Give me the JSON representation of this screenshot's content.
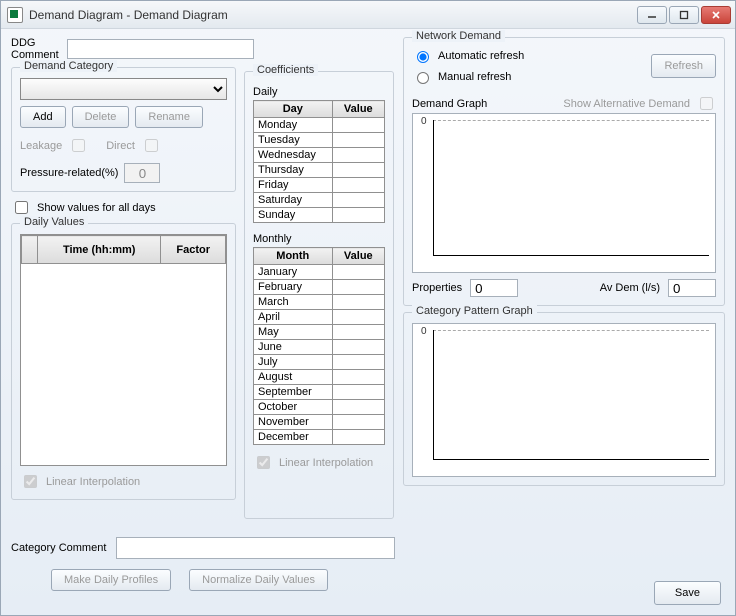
{
  "window": {
    "title": "Demand Diagram - Demand Diagram"
  },
  "ddg": {
    "label": "DDG Comment",
    "value": ""
  },
  "demand_category": {
    "legend": "Demand Category",
    "add": "Add",
    "delete": "Delete",
    "rename": "Rename",
    "leakage": "Leakage",
    "direct": "Direct",
    "pressure_label": "Pressure-related(%)",
    "pressure_value": "0",
    "show_all": "Show values for all days"
  },
  "daily_values": {
    "legend": "Daily Values",
    "headers": {
      "time": "Time (hh:mm)",
      "factor": "Factor"
    },
    "linear": "Linear Interpolation"
  },
  "coefficients": {
    "legend": "Coefficients",
    "daily_label": "Daily",
    "daily_headers": {
      "day": "Day",
      "value": "Value"
    },
    "days": [
      "Monday",
      "Tuesday",
      "Wednesday",
      "Thursday",
      "Friday",
      "Saturday",
      "Sunday"
    ],
    "monthly_label": "Monthly",
    "monthly_headers": {
      "month": "Month",
      "value": "Value"
    },
    "months": [
      "January",
      "February",
      "March",
      "April",
      "May",
      "June",
      "July",
      "August",
      "September",
      "October",
      "November",
      "December"
    ],
    "linear": "Linear Interpolation"
  },
  "network_demand": {
    "legend": "Network Demand",
    "auto": "Automatic refresh",
    "manual": "Manual refresh",
    "refresh": "Refresh",
    "demand_graph": "Demand Graph",
    "show_alt": "Show Alternative Demand",
    "properties_label": "Properties",
    "properties_value": "0",
    "avdem_label": "Av Dem (l/s)",
    "avdem_value": "0",
    "pattern_graph": "Category Pattern Graph"
  },
  "bottom": {
    "category_comment": "Category Comment",
    "make_daily": "Make Daily Profiles",
    "normalize": "Normalize Daily Values",
    "save": "Save"
  }
}
